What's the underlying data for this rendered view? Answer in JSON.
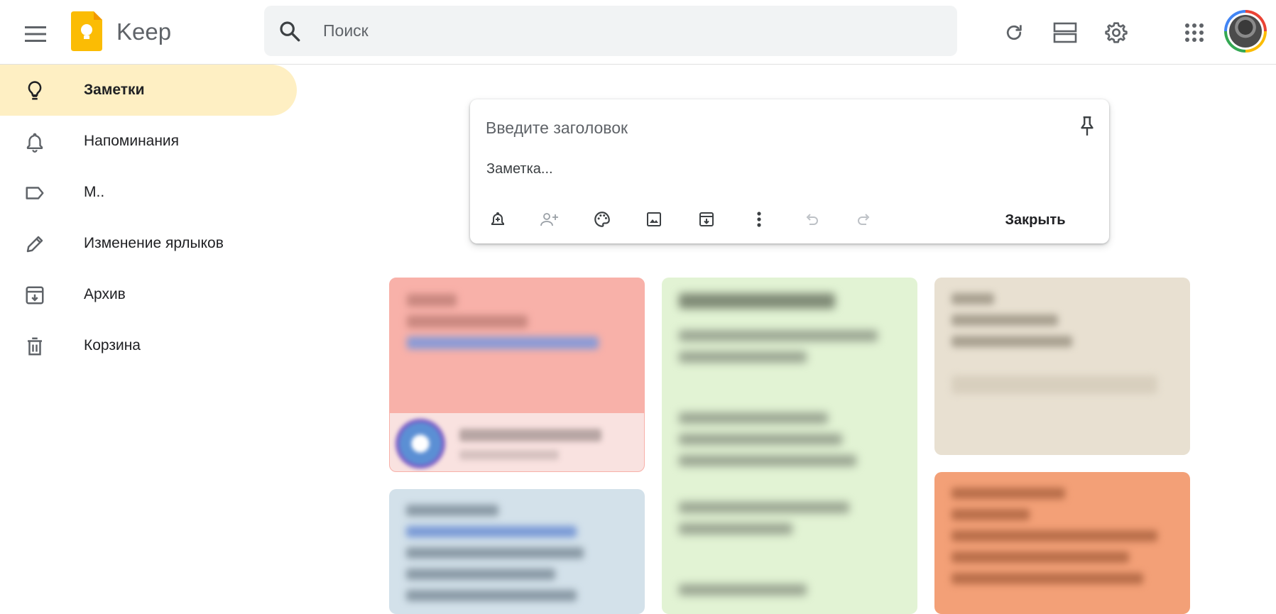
{
  "header": {
    "app_title": "Keep",
    "search_placeholder": "Поиск",
    "icons": [
      "menu-icon",
      "keep-logo",
      "search-icon",
      "refresh-icon",
      "list-view-icon",
      "settings-icon",
      "apps-grid-icon",
      "avatar"
    ]
  },
  "sidebar": {
    "items": [
      {
        "label": "Заметки",
        "icon": "lightbulb-icon",
        "active": true
      },
      {
        "label": "Напоминания",
        "icon": "bell-icon",
        "active": false
      },
      {
        "label": "М..",
        "icon": "label-icon",
        "active": false
      },
      {
        "label": "Изменение ярлыков",
        "icon": "pencil-icon",
        "active": false
      },
      {
        "label": "Архив",
        "icon": "archive-icon",
        "active": false
      },
      {
        "label": "Корзина",
        "icon": "trash-icon",
        "active": false
      }
    ]
  },
  "composer": {
    "title_placeholder": "Введите заголовок",
    "body_placeholder": "Заметка...",
    "close_label": "Закрыть",
    "tools": [
      "add-reminder-icon",
      "collaborator-icon",
      "palette-icon",
      "image-icon",
      "archive-icon",
      "more-icon",
      "undo-icon",
      "redo-icon"
    ]
  },
  "colors": {
    "active_nav": "#feefc3",
    "note_red": "#f8b1a9",
    "note_green": "#e2f3d4",
    "note_beige": "#e8e0d1",
    "note_blue": "#d3e1ea",
    "note_orange": "#f3a077"
  }
}
